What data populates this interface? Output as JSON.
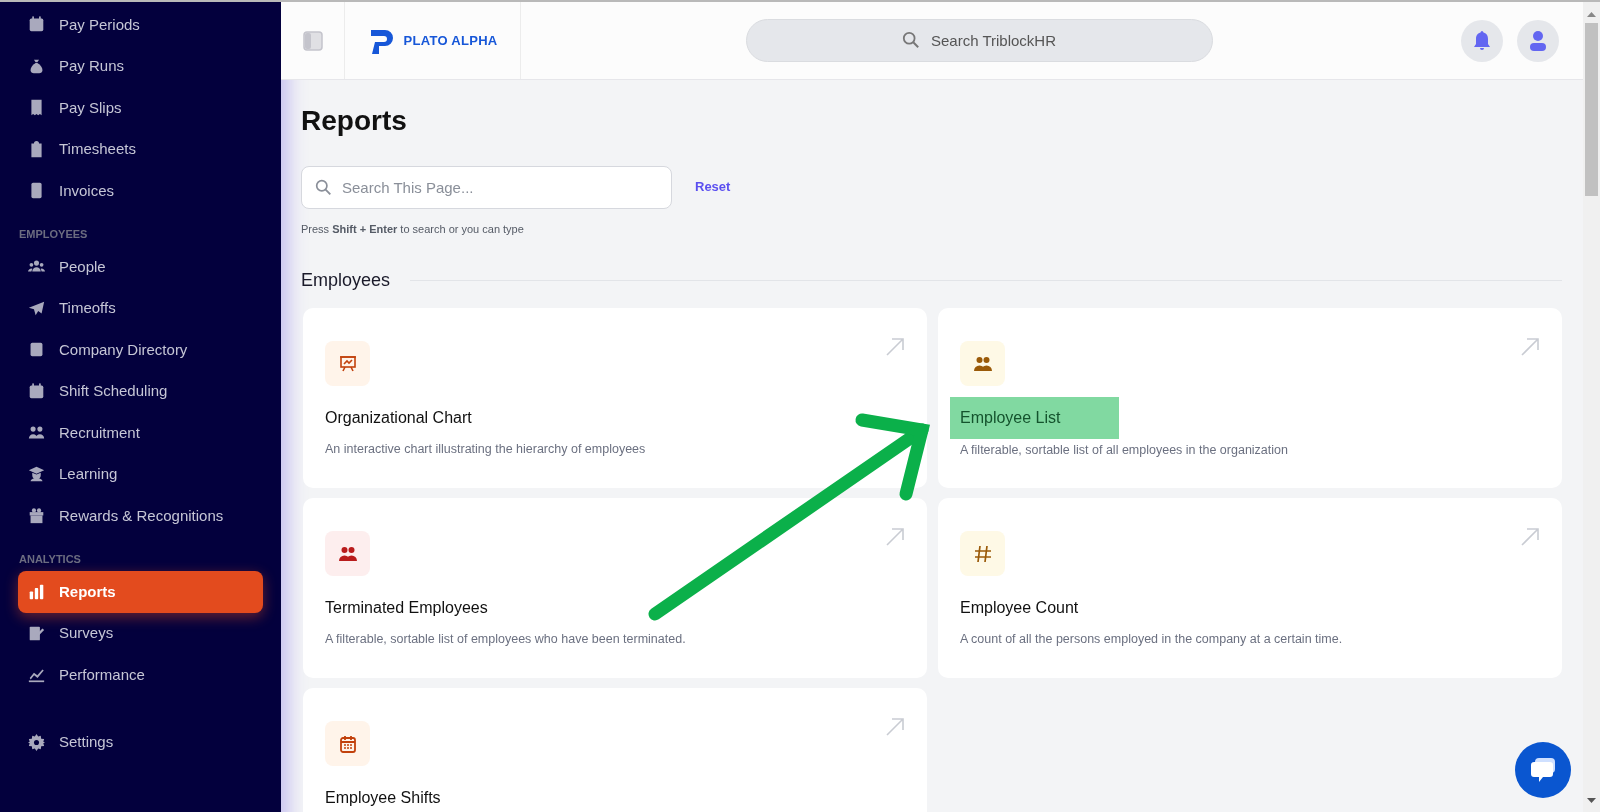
{
  "sidebar": {
    "groups": [
      {
        "items": [
          {
            "label": "Pay Periods",
            "selected": false
          },
          {
            "label": "Pay Runs",
            "selected": false
          },
          {
            "label": "Pay Slips",
            "selected": false
          },
          {
            "label": "Timesheets",
            "selected": false
          },
          {
            "label": "Invoices",
            "selected": false
          }
        ]
      },
      {
        "heading": "EMPLOYEES",
        "items": [
          {
            "label": "People",
            "selected": false
          },
          {
            "label": "Timeoffs",
            "selected": false
          },
          {
            "label": "Company Directory",
            "selected": false
          },
          {
            "label": "Shift Scheduling",
            "selected": false
          },
          {
            "label": "Recruitment",
            "selected": false
          },
          {
            "label": "Learning",
            "selected": false
          },
          {
            "label": "Rewards & Recognitions",
            "selected": false
          }
        ]
      },
      {
        "heading": "ANALYTICS",
        "items": [
          {
            "label": "Reports",
            "selected": true
          },
          {
            "label": "Surveys",
            "selected": false
          },
          {
            "label": "Performance",
            "selected": false
          }
        ]
      },
      {
        "items": [
          {
            "label": "Settings",
            "selected": false
          }
        ]
      }
    ]
  },
  "header": {
    "logo": "PLATO ALPHA",
    "search": {
      "placeholder": "Search TriblockHR"
    }
  },
  "page": {
    "title": "Reports",
    "search": {
      "placeholder": "Search This Page..."
    },
    "reset": "Reset",
    "hint": "Press **Shift + Enter** to search or you can type",
    "section": {
      "title": "Employees",
      "cards": [
        {
          "title": "Organizational Chart",
          "description": "An interactive chart illustrating the hierarchy of employees",
          "highlighted": false
        },
        {
          "title": "Employee List",
          "description": "A filterable, sortable list of all employees in the organization",
          "highlighted": true
        },
        {
          "title": "Terminated Employees",
          "description": "A filterable, sortable list of employees who have been terminated.",
          "highlighted": false
        },
        {
          "title": "Employee Count",
          "description": "A count of all the persons employed in the company at a certain time.",
          "highlighted": false
        },
        {
          "title": "Employee Shifts",
          "highlighted": false
        }
      ]
    }
  }
}
